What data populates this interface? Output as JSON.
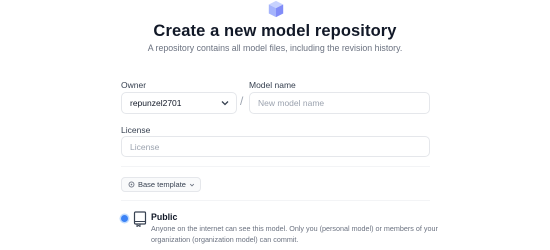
{
  "header": {
    "logo_icon": "cube-icon",
    "title": "Create a new model repository",
    "subtitle": "A repository contains all model files, including the revision history."
  },
  "form": {
    "owner_label": "Owner",
    "owner_value": "repunzel2701",
    "separator": "/",
    "model_name_label": "Model name",
    "model_name_placeholder": "New model name",
    "license_label": "License",
    "license_placeholder": "License",
    "base_template_label": "Base template",
    "visibility": {
      "selected": "public",
      "public_title": "Public",
      "public_description": "Anyone on the internet can see this model. Only you (personal model) or members of your organization (organization model) can commit."
    }
  },
  "colors": {
    "accent": "#3b82f6",
    "cube": "#a5b4fc"
  }
}
